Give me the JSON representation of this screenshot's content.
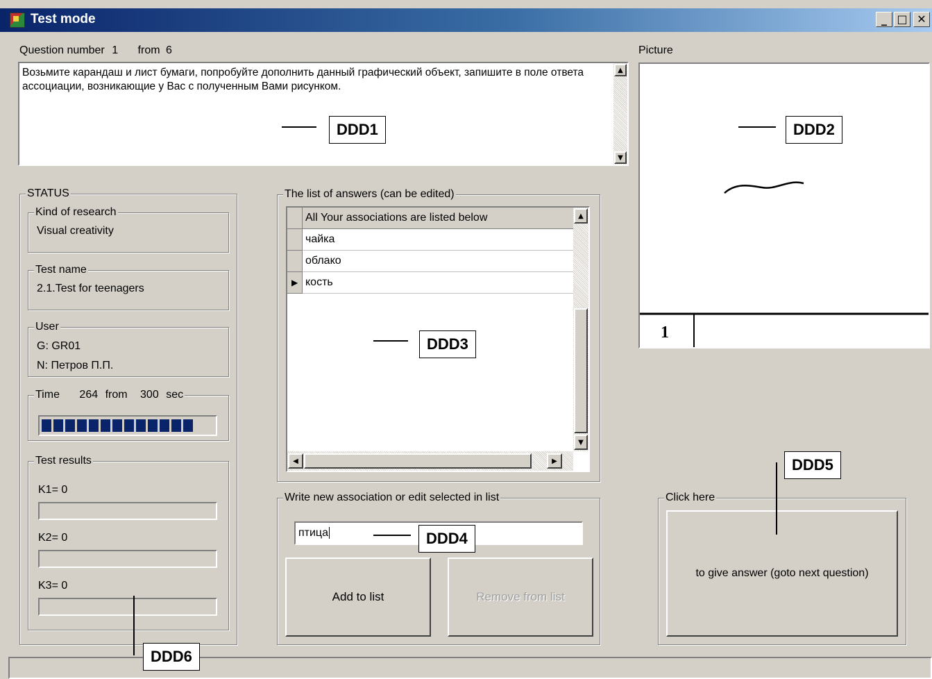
{
  "window": {
    "title": "Test mode"
  },
  "question": {
    "label": "Question number",
    "number": "1",
    "from_label": "from",
    "total": "6",
    "text": "Возьмите карандаш и лист бумаги, попробуйте дополнить данный графический объект, запишите в поле ответа ассоциации, возникающие у Вас с полученным Вами рисунком."
  },
  "picture": {
    "label": "Picture",
    "caption_number": "1"
  },
  "status": {
    "group_label": "STATUS",
    "research": {
      "label": "Kind of research",
      "value": "Visual creativity"
    },
    "test_name": {
      "label": "Test name",
      "value": "2.1.Test for teenagers"
    },
    "user": {
      "label": "User",
      "group": "G:  GR01",
      "name": "N:  Петров П.П."
    },
    "time": {
      "label": "Time",
      "current": "264",
      "from_label": "from",
      "max": "300",
      "unit": "sec",
      "progress_fraction": 0.88
    },
    "results": {
      "label": "Test results",
      "k1": {
        "label": "K1=",
        "value": "0",
        "fraction": 0
      },
      "k2": {
        "label": "K2=",
        "value": "0",
        "fraction": 0
      },
      "k3": {
        "label": "K3=",
        "value": "0",
        "fraction": 0
      }
    }
  },
  "answers": {
    "group_label": "The list of answers (can be edited)",
    "header": "All Your associations are listed below",
    "rows": [
      "чайка",
      "облако",
      "кость"
    ],
    "selected_row": 2
  },
  "new_association": {
    "group_label": "Write new association or edit selected in list",
    "value": "птица",
    "add_label": "Add to list",
    "remove_label": "Remove from list"
  },
  "click_here": {
    "group_label": "Click here",
    "button_label": "to give answer (goto next question)"
  },
  "annotations": [
    "DDD1",
    "DDD2",
    "DDD3",
    "DDD4",
    "DDD5",
    "DDD6"
  ],
  "colors": {
    "titlebar_start": "#0a246a",
    "progress": "#0a246a",
    "face": "#d4d0c8"
  }
}
